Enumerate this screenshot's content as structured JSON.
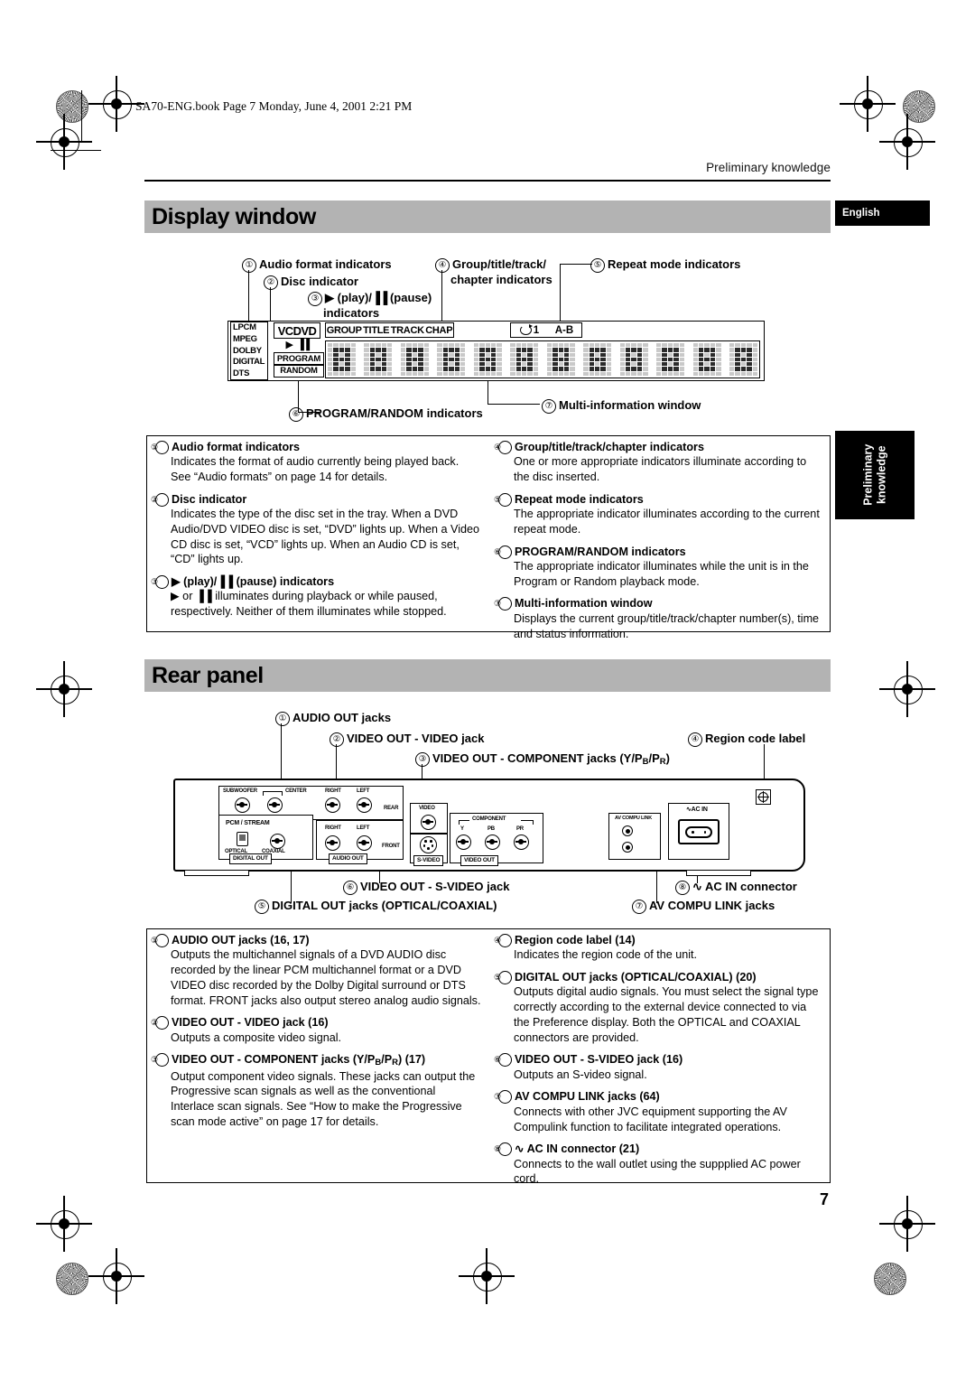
{
  "file_header": "SA70-ENG.book  Page 7  Monday, June 4, 2001  2:21 PM",
  "running_head": "Preliminary knowledge",
  "english_tab": "English",
  "side_tab": {
    "line1": "Preliminary",
    "line2": "knowledge"
  },
  "page_number": "7",
  "sections": {
    "display_window": {
      "title": "Display window"
    },
    "rear_panel": {
      "title": "Rear panel"
    }
  },
  "display_diagram": {
    "callouts": [
      {
        "num": "①",
        "text": "Audio format indicators"
      },
      {
        "num": "②",
        "text": "Disc indicator"
      },
      {
        "num": "③",
        "text": "▶ (play)/▐▐ (pause) indicators"
      },
      {
        "num": "④",
        "text": "Group/title/track/ chapter indicators"
      },
      {
        "num": "⑤",
        "text": "Repeat mode indicators"
      },
      {
        "num": "⑥",
        "text": "PROGRAM/RANDOM indicators"
      },
      {
        "num": "⑦",
        "text": "Multi-information window"
      }
    ],
    "callout_3_line1": "▶ (play)/",
    "callout_3_pause": "(pause)",
    "callout_3_line2": "indicators",
    "callout_4_line1": "Group/title/track/",
    "callout_4_line2": "chapter indicators",
    "audio_formats": [
      "LPCM",
      "MPEG",
      "DOLBY",
      "DIGITAL",
      "DTS"
    ],
    "disc_indicator": "VCDVD",
    "program_label": "PROGRAM",
    "random_label": "RANDOM",
    "gttc_labels": [
      "GROUP",
      "TITLE",
      "TRACK",
      "CHAP"
    ],
    "repeat_labels": [
      "1",
      "A-B"
    ],
    "matrix_cells": 12
  },
  "display_entries": [
    {
      "num": "①",
      "head": "Audio format indicators",
      "body": "Indicates the format of audio currently being played back. See “Audio formats” on page 14 for details."
    },
    {
      "num": "②",
      "head": "Disc indicator",
      "body": "Indicates the type of the disc set in the tray. When a DVD Audio/DVD VIDEO disc is set, “DVD” lights up. When a Video CD disc is set, “VCD” lights up. When an Audio CD is set, “CD” lights up."
    },
    {
      "num": "③",
      "head": "▶ (play)/▐▐ (pause) indicators",
      "body": "▶ or ▐▐ illuminates during playback or while paused, respectively. Neither of them illuminates while stopped."
    },
    {
      "num": "④",
      "head": "Group/title/track/chapter indicators",
      "body": "One or more appropriate indicators illuminate according to the disc inserted."
    },
    {
      "num": "⑤",
      "head": "Repeat mode indicators",
      "body": "The appropriate indicator illuminates according to the current repeat mode."
    },
    {
      "num": "⑥",
      "head": "PROGRAM/RANDOM indicators",
      "body": "The appropriate indicator illuminates while the unit is in the Program or Random playback mode."
    },
    {
      "num": "⑦",
      "head": "Multi-information window",
      "body": "Displays the current group/title/track/chapter number(s), time and status information."
    }
  ],
  "rear_diagram": {
    "callouts": {
      "c1": "AUDIO OUT jacks",
      "c2": "VIDEO OUT - VIDEO jack",
      "c3_pre": "VIDEO OUT - COMPONENT jacks (Y/P",
      "c3_sub1": "B",
      "c3_mid": "/P",
      "c3_sub2": "R",
      "c3_post": ")",
      "c4": "Region code label",
      "c5": "DIGITAL OUT jacks (OPTICAL/COAXIAL)",
      "c6": "VIDEO OUT - S-VIDEO jack",
      "c7": "AV COMPU LINK jacks",
      "c8": "∿ AC IN connector"
    },
    "panel_labels": {
      "subwoofer": "SUBWOOFER",
      "center": "CENTER",
      "right_rear": "RIGHT",
      "left_rear": "LEFT",
      "rear": "REAR",
      "right_front": "RIGHT",
      "left_front": "LEFT",
      "front": "FRONT",
      "pcm_stream": "PCM / STREAM",
      "optical": "OPTICAL",
      "coaxial": "COAXIAL",
      "digital_out": "DIGITAL OUT",
      "audio_out": "AUDIO OUT",
      "video": "VIDEO",
      "s_video": "S-VIDEO",
      "component": "COMPONENT",
      "comp_y": "Y",
      "comp_pb": "PB",
      "comp_pr": "PR",
      "video_out": "VIDEO OUT",
      "av_compu_link": "AV COMPU LINK",
      "ac_in": "∿AC IN"
    }
  },
  "rear_entries": [
    {
      "num": "①",
      "head": "AUDIO OUT jacks (16, 17)",
      "body": "Outputs the multichannel signals of a DVD AUDIO disc recorded by the linear PCM multichannel format or a DVD VIDEO disc recorded by the Dolby Digital surround or DTS format. FRONT jacks also output stereo analog audio signals."
    },
    {
      "num": "②",
      "head": "VIDEO OUT - VIDEO jack (16)",
      "body": "Outputs a composite video signal."
    },
    {
      "num": "③",
      "head": "VIDEO OUT - COMPONENT jacks (Y/PB/PR) (17)",
      "body": "Output component video signals. These jacks can output the Progressive scan signals as well as the conventional Interlace scan signals. See “How to make the Progressive scan mode active” on page 17 for details."
    },
    {
      "num": "④",
      "head": "Region code label (14)",
      "body": "Indicates the region code of the unit."
    },
    {
      "num": "⑤",
      "head": "DIGITAL OUT jacks (OPTICAL/COAXIAL) (20)",
      "body": "Outputs digital audio signals. You must select the signal type correctly according to the external device connected to via the Preference display. Both the OPTICAL and COAXIAL connectors are provided."
    },
    {
      "num": "⑥",
      "head": "VIDEO OUT - S-VIDEO jack (16)",
      "body": "Outputs an S-video signal."
    },
    {
      "num": "⑦",
      "head": "AV COMPU LINK jacks (64)",
      "body": "Connects with other JVC equipment supporting the AV Compulink function to facilitate integrated operations."
    },
    {
      "num": "⑧",
      "head": "∿ AC IN connector (21)",
      "body": "Connects to the wall outlet using the suppplied AC power cord."
    }
  ]
}
